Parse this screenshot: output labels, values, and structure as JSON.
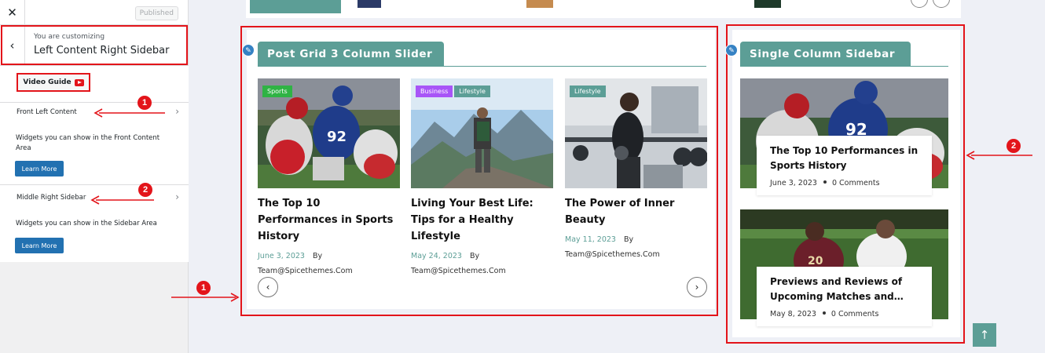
{
  "customizer": {
    "close_icon": "close-icon",
    "published_label": "Published",
    "you_are_customizing": "You are customizing",
    "section_title": "Left Content Right Sidebar",
    "video_guide_label": "Video Guide",
    "items": [
      {
        "label": "Front Left Content",
        "description": "Widgets you can show in the Front Content Area",
        "button": "Learn More"
      },
      {
        "label": "Middle Right Sidebar",
        "description": "Widgets you can show in the Sidebar Area",
        "button": "Learn More"
      }
    ]
  },
  "annotations": {
    "one": "1",
    "two": "2",
    "color": "#e3141a"
  },
  "slider": {
    "title": "Post Grid 3 Column Slider",
    "posts": [
      {
        "tags": [
          "Sports"
        ],
        "title": "The Top 10 Performances in Sports History",
        "date": "June 3, 2023",
        "by": "By",
        "author": "Team@Spicethemes.Com"
      },
      {
        "tags": [
          "Business",
          "Lifestyle"
        ],
        "title": "Living Your Best Life: Tips for a Healthy Lifestyle",
        "date": "May 24, 2023",
        "by": "By",
        "author": "Team@Spicethemes.Com"
      },
      {
        "tags": [
          "Lifestyle"
        ],
        "title": "The Power of Inner Beauty",
        "date": "May 11, 2023",
        "by": "By",
        "author": "Team@Spicethemes.Com"
      }
    ]
  },
  "sidebar": {
    "title": "Single Column Sidebar",
    "posts": [
      {
        "title": "The Top 10 Performances in Sports History",
        "date": "June 3, 2023",
        "comments": "0 Comments"
      },
      {
        "title": "Previews and Reviews of Upcoming Matches and…",
        "date": "May 8, 2023",
        "comments": "0 Comments"
      }
    ]
  },
  "colors": {
    "accent": "#5c9e96",
    "annotation_red": "#e3141a",
    "wp_blue": "#2271b1",
    "tag_sports": "#2fb344",
    "tag_business": "#a855f7",
    "tag_lifestyle": "#5c9e96"
  }
}
